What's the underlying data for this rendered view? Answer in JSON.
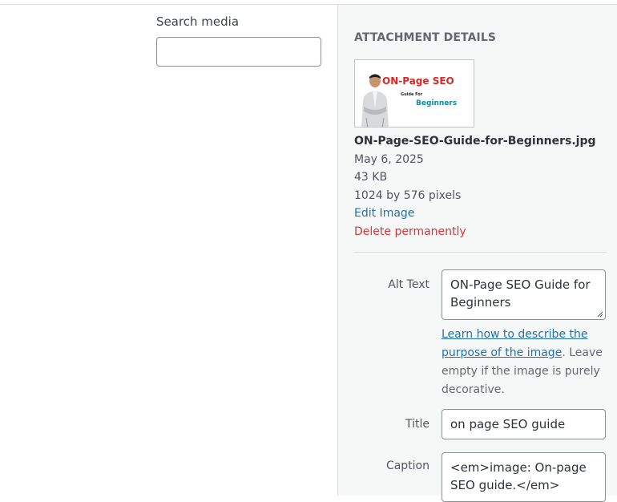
{
  "search": {
    "label": "Search media",
    "value": "",
    "placeholder": ""
  },
  "attachment": {
    "heading": "Attachment Details",
    "thumbnail": {
      "title": "ON-Page SEO",
      "subtitle": "Guide For",
      "highlight": "Beginners"
    },
    "file_name": "ON-Page-SEO-Guide-for-Beginners.jpg",
    "date": "May 6, 2025",
    "size": "43 KB",
    "dimensions": "1024 by 576 pixels",
    "edit_label": "Edit Image",
    "delete_label": "Delete permanently"
  },
  "fields": {
    "alt_text": {
      "label": "Alt Text",
      "value": "ON-Page SEO Guide for Beginners"
    },
    "help": {
      "link_text": "Learn how to describe the purpose of the image",
      "rest_text": ". Leave empty if the image is purely decorative."
    },
    "title": {
      "label": "Title",
      "value": "on page SEO guide"
    },
    "caption": {
      "label": "Caption",
      "value": "<em>image: On-page SEO guide.</em>"
    }
  },
  "colors": {
    "link": "#2271b1",
    "delete": "#d63638",
    "sidebar_bg": "#f6f7f7"
  }
}
